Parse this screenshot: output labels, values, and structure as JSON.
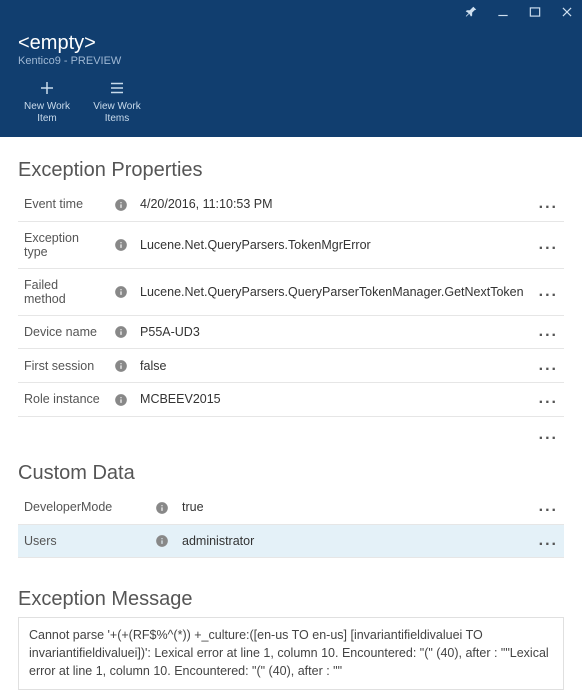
{
  "header": {
    "title": "<empty>",
    "subtitle": "Kentico9 - PREVIEW",
    "toolbar": {
      "new_work_item": "New Work Item",
      "view_work_items": "View Work Items"
    }
  },
  "sections": {
    "exception_properties": {
      "title": "Exception Properties",
      "rows": [
        {
          "label": "Event time",
          "value": "4/20/2016, 11:10:53 PM"
        },
        {
          "label": "Exception type",
          "value": "Lucene.Net.QueryParsers.TokenMgrError"
        },
        {
          "label": "Failed method",
          "value": "Lucene.Net.QueryParsers.QueryParserTokenManager.GetNextToken"
        },
        {
          "label": "Device name",
          "value": "P55A-UD3"
        },
        {
          "label": "First session",
          "value": "false"
        },
        {
          "label": "Role instance",
          "value": "MCBEEV2015"
        }
      ]
    },
    "custom_data": {
      "title": "Custom Data",
      "rows": [
        {
          "label": "DeveloperMode",
          "value": "true"
        },
        {
          "label": "Users",
          "value": "administrator"
        }
      ]
    },
    "exception_message": {
      "title": "Exception Message",
      "body": "Cannot parse '+(+(RF$%^(*)) +_culture:([en-us TO en-us] [invariantifieldivaluei TO invariantifieldivaluei])': Lexical error at line 1, column 10. Encountered: \"(\" (40), after : \"\"Lexical error at line 1, column 10. Encountered: \"(\" (40), after : \"\""
    }
  }
}
